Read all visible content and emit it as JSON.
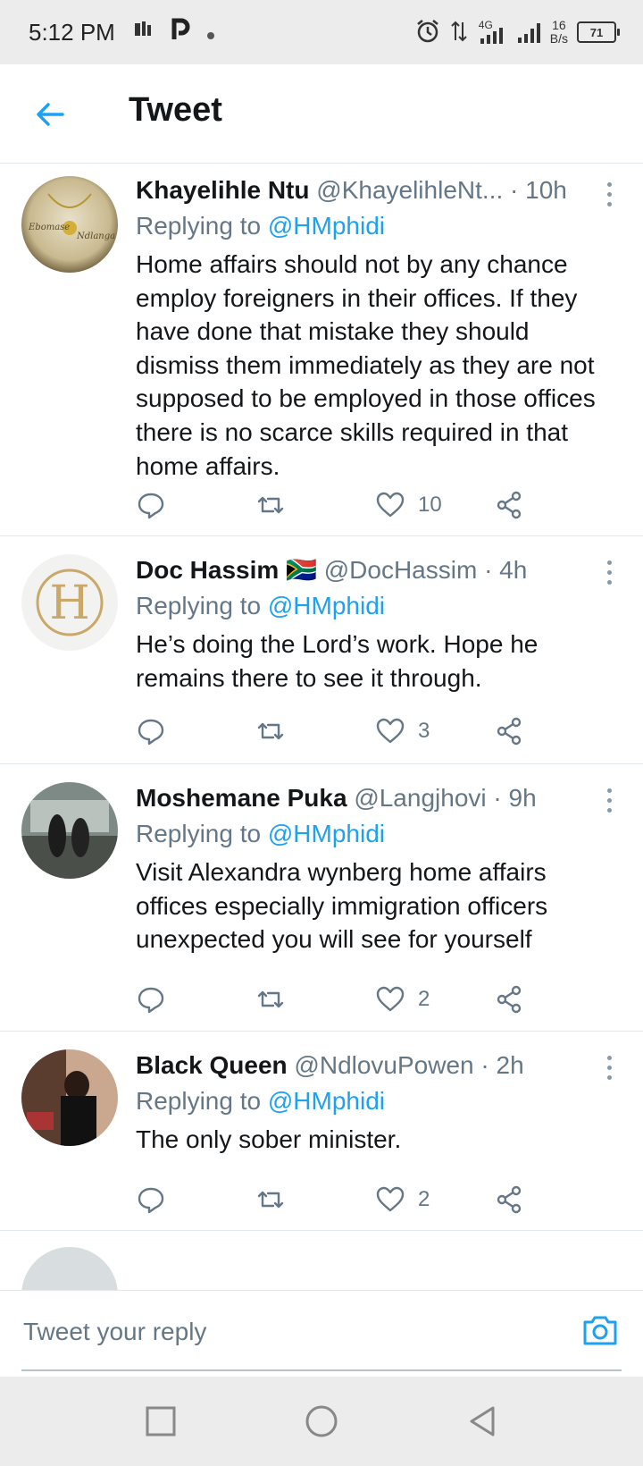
{
  "status_bar": {
    "time": "5:12 PM",
    "net_type": "4G",
    "net_speed_value": "16",
    "net_speed_unit": "B/s",
    "battery": "71"
  },
  "header": {
    "title": "Tweet",
    "back_icon": "arrow-left-icon"
  },
  "colors": {
    "accent": "#1da1f2",
    "secondary_text": "#657786",
    "primary_text": "#14171a",
    "divider": "#e1e8ed"
  },
  "tweets": [
    {
      "name": "Khayelihle Ntu",
      "handle": "@KhayelihleNt...",
      "time": "· 10h",
      "replying_prefix": "Replying to",
      "replying_handle": "@HMphidi",
      "text": "Home affairs should not by any chance employ foreigners in their offices. If they have done that mistake they should dismiss them immediately as they are not supposed to be employed in those offices there is no scarce skills required in that home affairs.",
      "likes": "10"
    },
    {
      "name": "Doc Hassim",
      "flag": "🇿🇦",
      "handle": "@DocHassim",
      "time": "· 4h",
      "replying_prefix": "Replying to",
      "replying_handle": "@HMphidi",
      "text": "He’s doing the Lord’s work. Hope he remains there to see it through.",
      "likes": "3"
    },
    {
      "name": "Moshemane Puka",
      "handle": "@Langjhovi",
      "time": "· 9h",
      "replying_prefix": "Replying to",
      "replying_handle": "@HMphidi",
      "text": "Visit Alexandra wynberg home affairs offices especially immigration officers unexpected you will see for yourself",
      "likes": "2"
    },
    {
      "name": "Black Queen",
      "handle": "@NdlovuPowen",
      "time": "· 2h",
      "replying_prefix": "Replying to",
      "replying_handle": "@HMphidi",
      "text": "The only sober minister.",
      "likes": "2"
    }
  ],
  "reply_bar": {
    "placeholder": "Tweet your reply"
  }
}
